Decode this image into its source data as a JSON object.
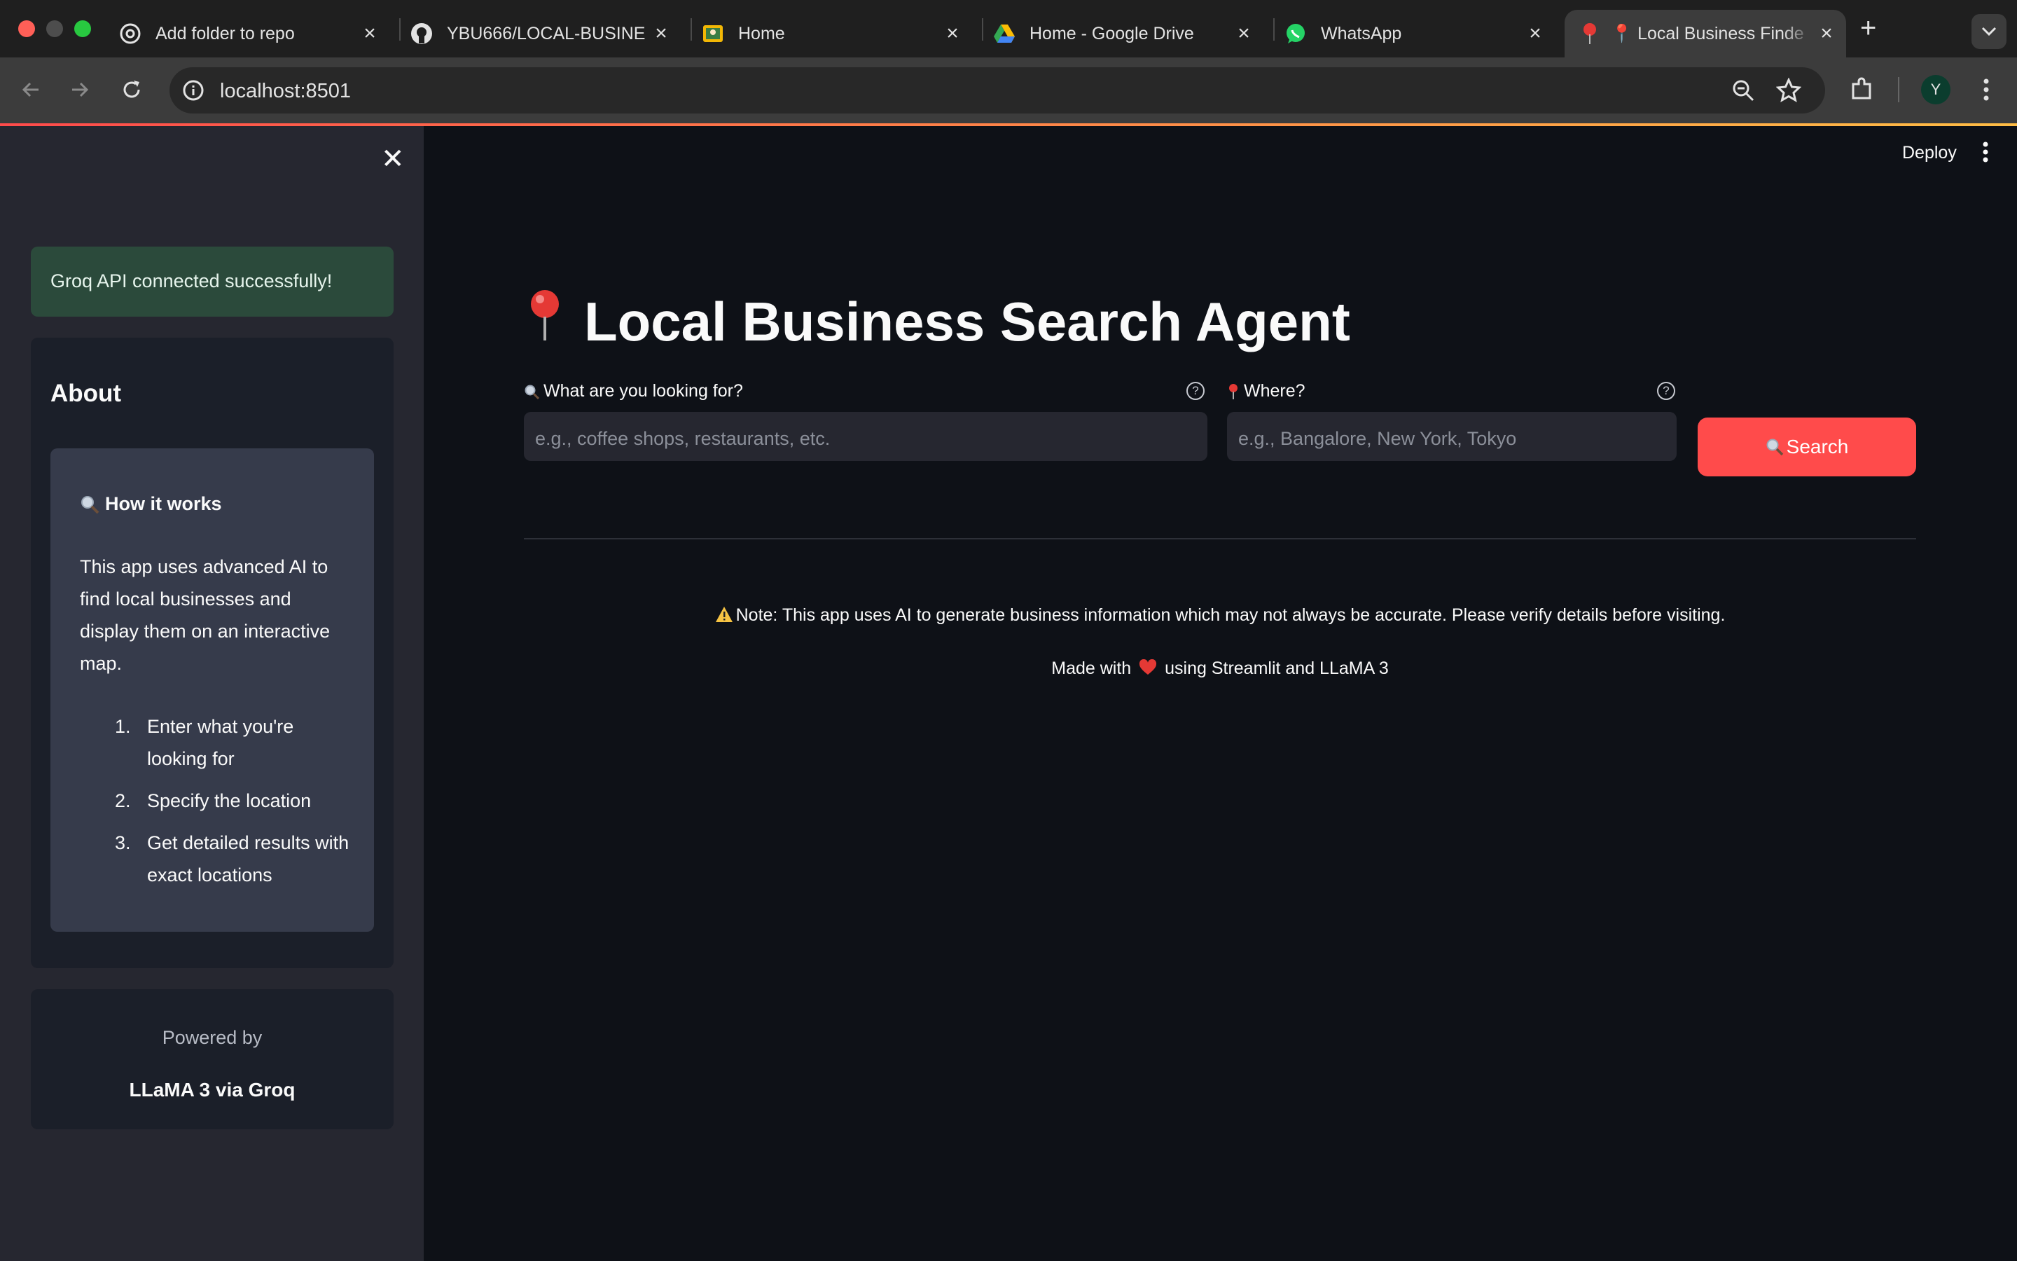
{
  "browser": {
    "tabs": [
      {
        "title": "Add folder to repo",
        "icon": "openai-icon"
      },
      {
        "title": "YBU666/LOCAL-BUSINE",
        "icon": "github-icon"
      },
      {
        "title": "Home",
        "icon": "home-photo-icon"
      },
      {
        "title": "Home - Google Drive",
        "icon": "google-drive-icon"
      },
      {
        "title": "WhatsApp",
        "icon": "whatsapp-icon"
      },
      {
        "title": "📍 Local Business Finde",
        "icon": "pin-icon"
      }
    ],
    "url": "localhost:8501",
    "profile_initial": "Y",
    "colors": {
      "tabbar": "#1f1f1f",
      "toolbar": "#3c3c3c",
      "close_red": "#ff5f57",
      "minimize_yellow": "#febc2e",
      "zoom_green": "#28c840"
    }
  },
  "sidebar": {
    "status": "Groq API connected successfully!",
    "about_title": "About",
    "how_title": "How it works",
    "how_body": "This app uses advanced AI to find local businesses and display them on an interactive map.",
    "steps": [
      {
        "num": "1.",
        "text": "Enter what you're looking for"
      },
      {
        "num": "2.",
        "text": "Specify the location"
      },
      {
        "num": "3.",
        "text": "Get detailed results with exact locations"
      }
    ],
    "powered_by_label": "Powered by",
    "powered_by_model": "LLaMA 3 via Groq"
  },
  "header": {
    "deploy_label": "Deploy"
  },
  "main": {
    "title": "Local Business Search Agent",
    "query_label": "What are you looking for?",
    "query_placeholder": "e.g., coffee shops, restaurants, etc.",
    "location_label": "Where?",
    "location_placeholder": "e.g., Bangalore, New York, Tokyo",
    "search_button": "Search",
    "note": "Note: This app uses AI to generate business information which may not always be accurate. Please verify details before visiting.",
    "made_prefix": "Made with",
    "made_suffix": "using Streamlit and LLaMA 3",
    "accent_color": "#ff4b4b"
  }
}
